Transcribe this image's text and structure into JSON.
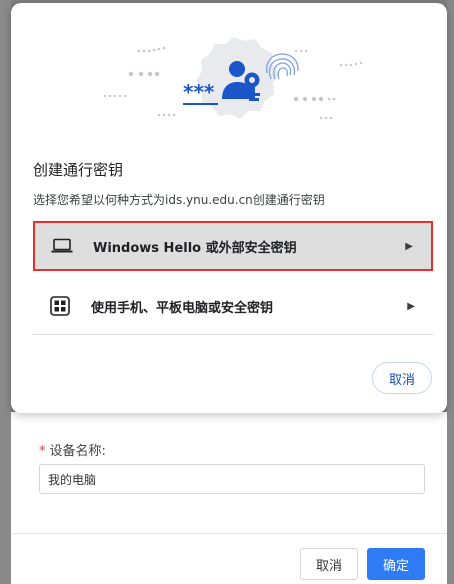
{
  "dialog": {
    "title": "创建通行密钥",
    "subtitle": "选择您希望以何种方式为ids.ynu.edu.cn创建通行密钥",
    "options": [
      {
        "label": "Windows Hello 或外部安全密钥",
        "icon": "laptop-icon"
      },
      {
        "label": "使用手机、平板电脑或安全密钥",
        "icon": "qr-code-icon"
      }
    ],
    "cancel_label": "取消",
    "hero_password_mask": "***",
    "hero_icons": [
      "passkey-icon",
      "fingerprint-icon"
    ]
  },
  "form": {
    "required_mark": "*",
    "device_name_label": "设备名称:",
    "device_name_value": "我的电脑",
    "cancel_label": "取消",
    "confirm_label": "确定"
  },
  "colors": {
    "accent": "#2f7bf6",
    "passkey_blue": "#1a56c9",
    "highlight_border": "#e5302c"
  }
}
